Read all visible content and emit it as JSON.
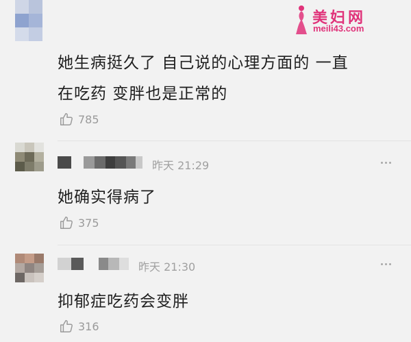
{
  "watermark": {
    "name": "美妇网",
    "url": "meili43.com"
  },
  "comments": [
    {
      "text_line1": "她生病挺久了 自己说的心理方面的 一直",
      "text_line2": "在吃药 变胖也是正常的",
      "likes": "785"
    },
    {
      "time": "昨天 21:29",
      "text": "她确实得病了",
      "likes": "375"
    },
    {
      "time": "昨天 21:30",
      "text": "抑郁症吃药会变胖",
      "likes": "316"
    }
  ],
  "icons": {
    "like": "thumbs-up-icon",
    "more": "more-dots-icon"
  }
}
